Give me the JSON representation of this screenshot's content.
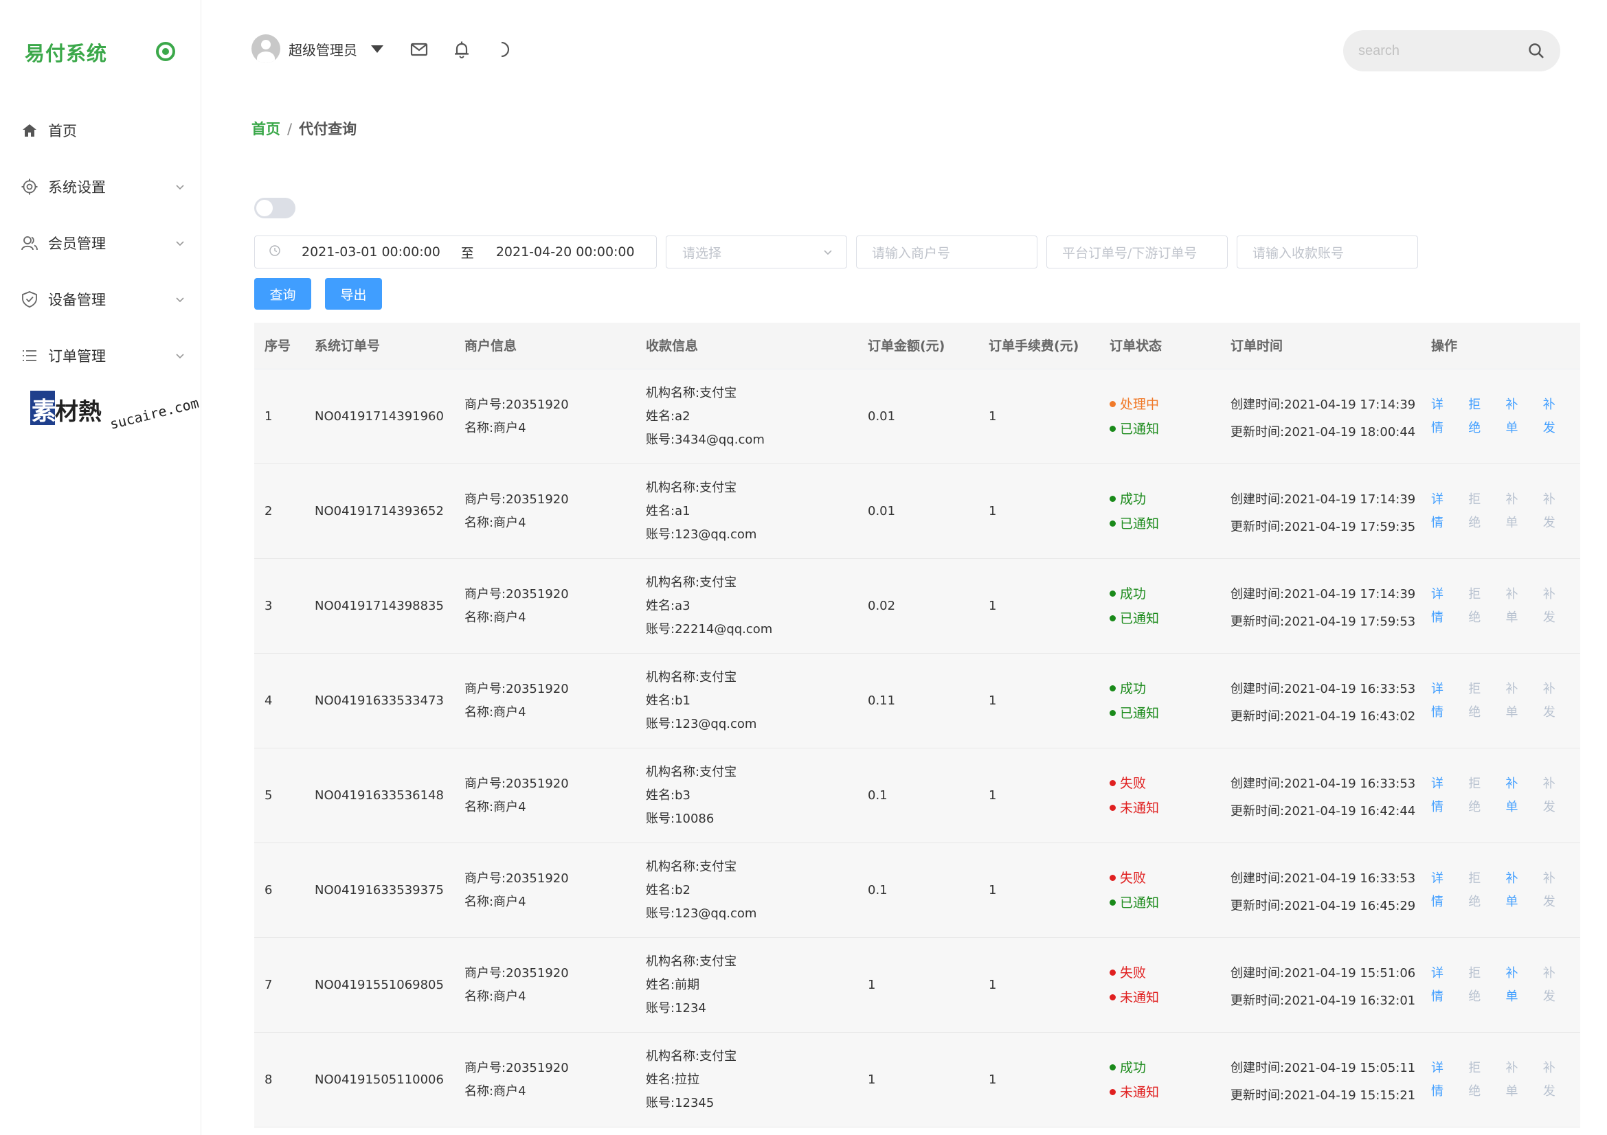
{
  "app": {
    "brand": "易付系统"
  },
  "sidebar": {
    "items": [
      {
        "label": "首页",
        "icon": "home-icon"
      },
      {
        "label": "系统设置",
        "icon": "gear-icon"
      },
      {
        "label": "会员管理",
        "icon": "users-icon"
      },
      {
        "label": "设备管理",
        "icon": "shield-icon"
      },
      {
        "label": "订单管理",
        "icon": "list-icon"
      }
    ],
    "watermark": {
      "text": "素材熱",
      "url": "sucaire.com"
    }
  },
  "header": {
    "user_name": "超级管理员",
    "search_placeholder": "search"
  },
  "breadcrumb": {
    "home": "首页",
    "sep": "/",
    "current": "代付查询"
  },
  "filters": {
    "date_start": "2021-03-01 00:00:00",
    "date_sep": "至",
    "date_end": "2021-04-20 00:00:00",
    "select_placeholder": "请选择",
    "merchant_placeholder": "请输入商户号",
    "order_placeholder": "平台订单号/下游订单号",
    "account_placeholder": "请输入收款账号",
    "query_label": "查询",
    "export_label": "导出"
  },
  "colors": {
    "brand": "#3ba84a",
    "primary": "#409eff",
    "success": "#1a8a1a",
    "danger": "#e02020",
    "warning": "#f07a2a"
  },
  "table": {
    "columns": [
      "序号",
      "系统订单号",
      "商户信息",
      "收款信息",
      "订单金额(元)",
      "订单手续费(元)",
      "订单状态",
      "订单时间",
      "操作"
    ],
    "rows": [
      {
        "idx": "1",
        "order_no": "NO04191714391960",
        "merchant_no": "商户号:20351920",
        "merchant_name": "名称:商户4",
        "org": "机构名称:支付宝",
        "name": "姓名:a2",
        "account": "账号:3434@qq.com",
        "amount": "0.01",
        "fee": "1",
        "status": "处理中",
        "status_color": "#f07a2a",
        "notify": "已通知",
        "notify_color": "#1a8a1a",
        "created": "创建时间:2021-04-19 17:14:39",
        "updated": "更新时间:2021-04-19 18:00:44",
        "ops": [
          {
            "label": "详情",
            "on": true
          },
          {
            "label": "拒绝",
            "on": true
          },
          {
            "label": "补单",
            "on": true
          },
          {
            "label": "补发",
            "on": true
          }
        ]
      },
      {
        "idx": "2",
        "order_no": "NO04191714393652",
        "merchant_no": "商户号:20351920",
        "merchant_name": "名称:商户4",
        "org": "机构名称:支付宝",
        "name": "姓名:a1",
        "account": "账号:123@qq.com",
        "amount": "0.01",
        "fee": "1",
        "status": "成功",
        "status_color": "#1a8a1a",
        "notify": "已通知",
        "notify_color": "#1a8a1a",
        "created": "创建时间:2021-04-19 17:14:39",
        "updated": "更新时间:2021-04-19 17:59:35",
        "ops": [
          {
            "label": "详情",
            "on": true
          },
          {
            "label": "拒绝",
            "on": false
          },
          {
            "label": "补单",
            "on": false
          },
          {
            "label": "补发",
            "on": false
          }
        ]
      },
      {
        "idx": "3",
        "order_no": "NO04191714398835",
        "merchant_no": "商户号:20351920",
        "merchant_name": "名称:商户4",
        "org": "机构名称:支付宝",
        "name": "姓名:a3",
        "account": "账号:22214@qq.com",
        "amount": "0.02",
        "fee": "1",
        "status": "成功",
        "status_color": "#1a8a1a",
        "notify": "已通知",
        "notify_color": "#1a8a1a",
        "created": "创建时间:2021-04-19 17:14:39",
        "updated": "更新时间:2021-04-19 17:59:53",
        "ops": [
          {
            "label": "详情",
            "on": true
          },
          {
            "label": "拒绝",
            "on": false
          },
          {
            "label": "补单",
            "on": false
          },
          {
            "label": "补发",
            "on": false
          }
        ]
      },
      {
        "idx": "4",
        "order_no": "NO04191633533473",
        "merchant_no": "商户号:20351920",
        "merchant_name": "名称:商户4",
        "org": "机构名称:支付宝",
        "name": "姓名:b1",
        "account": "账号:123@qq.com",
        "amount": "0.11",
        "fee": "1",
        "status": "成功",
        "status_color": "#1a8a1a",
        "notify": "已通知",
        "notify_color": "#1a8a1a",
        "created": "创建时间:2021-04-19 16:33:53",
        "updated": "更新时间:2021-04-19 16:43:02",
        "ops": [
          {
            "label": "详情",
            "on": true
          },
          {
            "label": "拒绝",
            "on": false
          },
          {
            "label": "补单",
            "on": false
          },
          {
            "label": "补发",
            "on": false
          }
        ]
      },
      {
        "idx": "5",
        "order_no": "NO04191633536148",
        "merchant_no": "商户号:20351920",
        "merchant_name": "名称:商户4",
        "org": "机构名称:支付宝",
        "name": "姓名:b3",
        "account": "账号:10086",
        "amount": "0.1",
        "fee": "1",
        "status": "失败",
        "status_color": "#e02020",
        "notify": "未通知",
        "notify_color": "#e02020",
        "created": "创建时间:2021-04-19 16:33:53",
        "updated": "更新时间:2021-04-19 16:42:44",
        "ops": [
          {
            "label": "详情",
            "on": true
          },
          {
            "label": "拒绝",
            "on": false
          },
          {
            "label": "补单",
            "on": true
          },
          {
            "label": "补发",
            "on": false
          }
        ]
      },
      {
        "idx": "6",
        "order_no": "NO04191633539375",
        "merchant_no": "商户号:20351920",
        "merchant_name": "名称:商户4",
        "org": "机构名称:支付宝",
        "name": "姓名:b2",
        "account": "账号:123@qq.com",
        "amount": "0.1",
        "fee": "1",
        "status": "失败",
        "status_color": "#e02020",
        "notify": "已通知",
        "notify_color": "#1a8a1a",
        "created": "创建时间:2021-04-19 16:33:53",
        "updated": "更新时间:2021-04-19 16:45:29",
        "ops": [
          {
            "label": "详情",
            "on": true
          },
          {
            "label": "拒绝",
            "on": false
          },
          {
            "label": "补单",
            "on": true
          },
          {
            "label": "补发",
            "on": false
          }
        ]
      },
      {
        "idx": "7",
        "order_no": "NO04191551069805",
        "merchant_no": "商户号:20351920",
        "merchant_name": "名称:商户4",
        "org": "机构名称:支付宝",
        "name": "姓名:前期",
        "account": "账号:1234",
        "amount": "1",
        "fee": "1",
        "status": "失败",
        "status_color": "#e02020",
        "notify": "未通知",
        "notify_color": "#e02020",
        "created": "创建时间:2021-04-19 15:51:06",
        "updated": "更新时间:2021-04-19 16:32:01",
        "ops": [
          {
            "label": "详情",
            "on": true
          },
          {
            "label": "拒绝",
            "on": false
          },
          {
            "label": "补单",
            "on": true
          },
          {
            "label": "补发",
            "on": false
          }
        ]
      },
      {
        "idx": "8",
        "order_no": "NO04191505110006",
        "merchant_no": "商户号:20351920",
        "merchant_name": "名称:商户4",
        "org": "机构名称:支付宝",
        "name": "姓名:拉拉",
        "account": "账号:12345",
        "amount": "1",
        "fee": "1",
        "status": "成功",
        "status_color": "#1a8a1a",
        "notify": "未通知",
        "notify_color": "#e02020",
        "created": "创建时间:2021-04-19 15:05:11",
        "updated": "更新时间:2021-04-19 15:15:21",
        "ops": [
          {
            "label": "详情",
            "on": true
          },
          {
            "label": "拒绝",
            "on": false
          },
          {
            "label": "补单",
            "on": false
          },
          {
            "label": "补发",
            "on": false
          }
        ]
      }
    ]
  }
}
